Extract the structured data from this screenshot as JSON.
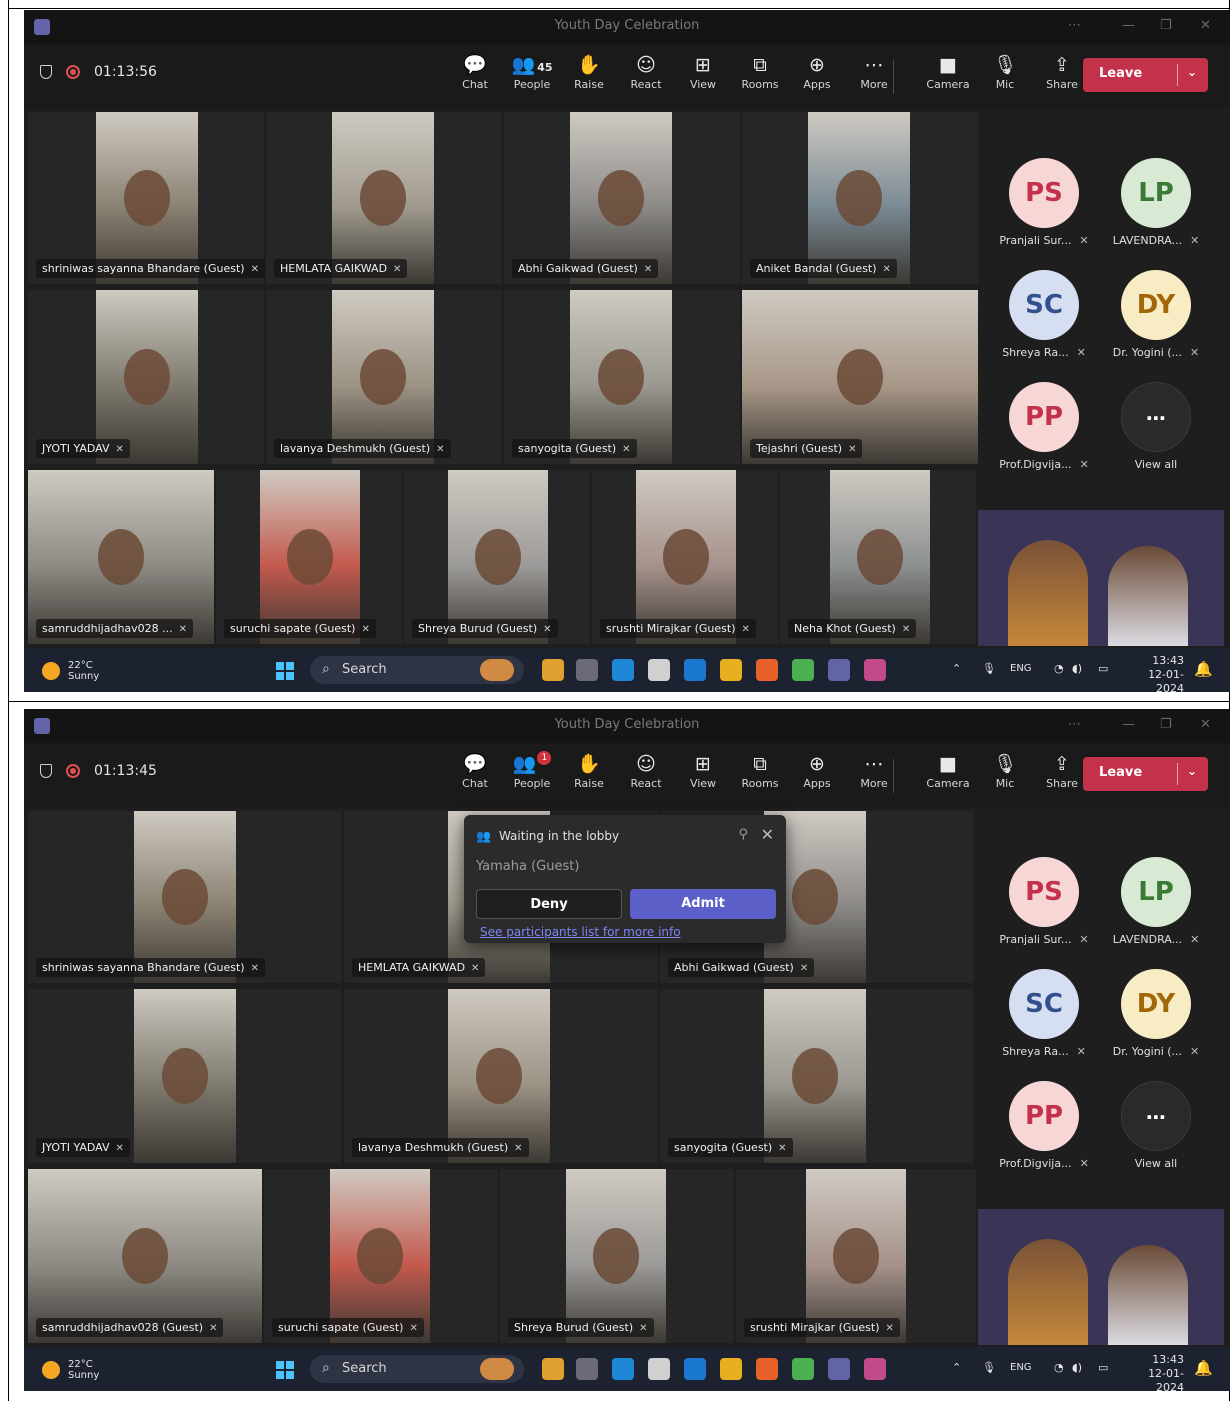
{
  "shots": [
    {
      "title": "Youth Day Celebration",
      "timer": "01:13:56",
      "toolbar": {
        "chat": "Chat",
        "people": "People",
        "people_count": "45",
        "raise": "Raise",
        "react": "React",
        "view": "View",
        "rooms": "Rooms",
        "apps": "Apps",
        "more": "More",
        "camera": "Camera",
        "mic": "Mic",
        "share": "Share",
        "leave": "Leave"
      },
      "tiles": [
        "shriniwas sayanna Bhandare (Guest)",
        "HEMLATA GAIKWAD",
        "Abhi Gaikwad (Guest)",
        "Aniket Bandal (Guest)",
        "JYOTI YADAV",
        "lavanya Deshmukh (Guest)",
        "sanyogita (Guest)",
        "Tejashri (Guest)",
        "samruddhijadhav028 ...",
        "suruchi sapate (Guest)",
        "Shreya Burud (Guest)",
        "srushti Mirajkar (Guest)",
        "Neha Khot (Guest)"
      ],
      "roster": [
        {
          "initials": "PS",
          "name": "Pranjali Sur...",
          "bg": "#f7d6d6",
          "fg": "#c4314b"
        },
        {
          "initials": "LP",
          "name": "LAVENDRA...",
          "bg": "#d8ead4",
          "fg": "#3b7a35"
        },
        {
          "initials": "SC",
          "name": "Shreya Ra...",
          "bg": "#d6def2",
          "fg": "#33508e"
        },
        {
          "initials": "DY",
          "name": "Dr. Yogini (...",
          "bg": "#f8ecc4",
          "fg": "#a3670a"
        },
        {
          "initials": "PP",
          "name": "Prof.Digvija...",
          "bg": "#f7d6d6",
          "fg": "#c4314b"
        }
      ],
      "view_all": "View all",
      "taskbar": {
        "temp": "22°C",
        "weather": "Sunny",
        "search": "Search",
        "lang": "ENG",
        "time": "13:43",
        "date": "12-01-2024"
      }
    },
    {
      "title": "Youth Day Celebration",
      "timer": "01:13:45",
      "toolbar": {
        "chat": "Chat",
        "people": "People",
        "people_badge": "1",
        "raise": "Raise",
        "react": "React",
        "view": "View",
        "rooms": "Rooms",
        "apps": "Apps",
        "more": "More",
        "camera": "Camera",
        "mic": "Mic",
        "share": "Share",
        "leave": "Leave"
      },
      "tiles": [
        "shriniwas sayanna Bhandare (Guest)",
        "HEMLATA GAIKWAD",
        "Abhi Gaikwad (Guest)",
        "JYOTI YADAV",
        "lavanya Deshmukh (Guest)",
        "sanyogita (Guest)",
        "samruddhijadhav028 (Guest)",
        "suruchi sapate (Guest)",
        "Shreya Burud (Guest)",
        "srushti Mirajkar (Guest)"
      ],
      "roster": [
        {
          "initials": "PS",
          "name": "Pranjali Sur...",
          "bg": "#f7d6d6",
          "fg": "#c4314b"
        },
        {
          "initials": "LP",
          "name": "LAVENDRA...",
          "bg": "#d8ead4",
          "fg": "#3b7a35"
        },
        {
          "initials": "SC",
          "name": "Shreya Ra...",
          "bg": "#d6def2",
          "fg": "#33508e"
        },
        {
          "initials": "DY",
          "name": "Dr. Yogini (...",
          "bg": "#f8ecc4",
          "fg": "#a3670a"
        },
        {
          "initials": "PP",
          "name": "Prof.Digvija...",
          "bg": "#f7d6d6",
          "fg": "#c4314b"
        }
      ],
      "view_all": "View all",
      "lobby": {
        "heading": "Waiting in the lobby",
        "guest": "Yamaha (Guest)",
        "deny": "Deny",
        "admit": "Admit",
        "link": "See participants list for more info"
      },
      "taskbar": {
        "temp": "22°C",
        "weather": "Sunny",
        "search": "Search",
        "lang": "ENG",
        "time": "13:43",
        "date": "12-01-2024"
      }
    }
  ]
}
